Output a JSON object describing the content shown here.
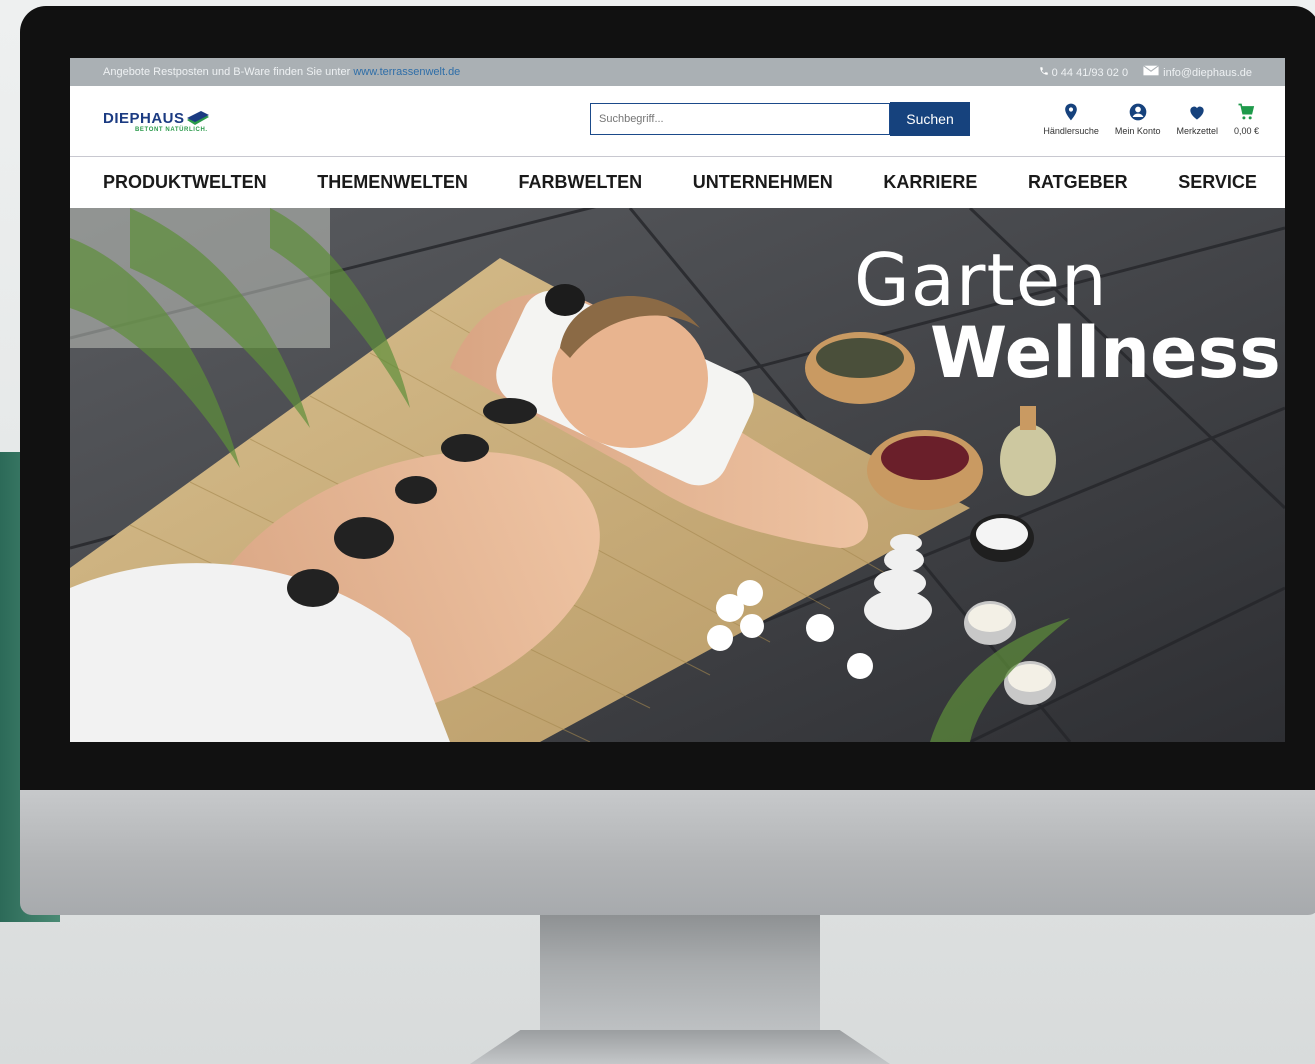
{
  "topbar": {
    "promo_text": "Angebote Restposten und B-Ware finden Sie unter",
    "promo_link": "www.terrassenwelt.de",
    "phone": "0 44 41/93 02 0",
    "email": "info@diephaus.de"
  },
  "logo": {
    "brand": "DIEPHAUS",
    "tagline": "BETONT NATÜRLICH."
  },
  "search": {
    "placeholder": "Suchbegriff...",
    "button_label": "Suchen"
  },
  "actions": [
    {
      "label": "Händlersuche",
      "icon": "location-pin-icon"
    },
    {
      "label": "Mein Konto",
      "icon": "user-icon"
    },
    {
      "label": "Merkzettel",
      "icon": "heart-icon"
    },
    {
      "label": "0,00 €",
      "icon": "cart-icon"
    }
  ],
  "nav": {
    "items": [
      "PRODUKTWELTEN",
      "THEMENWELTEN",
      "FARBWELTEN",
      "UNTERNEHMEN",
      "KARRIERE",
      "RATGEBER",
      "SERVICE"
    ]
  },
  "hero": {
    "line1": "Garten",
    "line2": "Wellness"
  },
  "colors": {
    "brand_blue": "#16427d",
    "brand_green": "#2a9a4a",
    "cart_green": "#1f9a4b",
    "topbar_bg": "#aab0b4"
  }
}
